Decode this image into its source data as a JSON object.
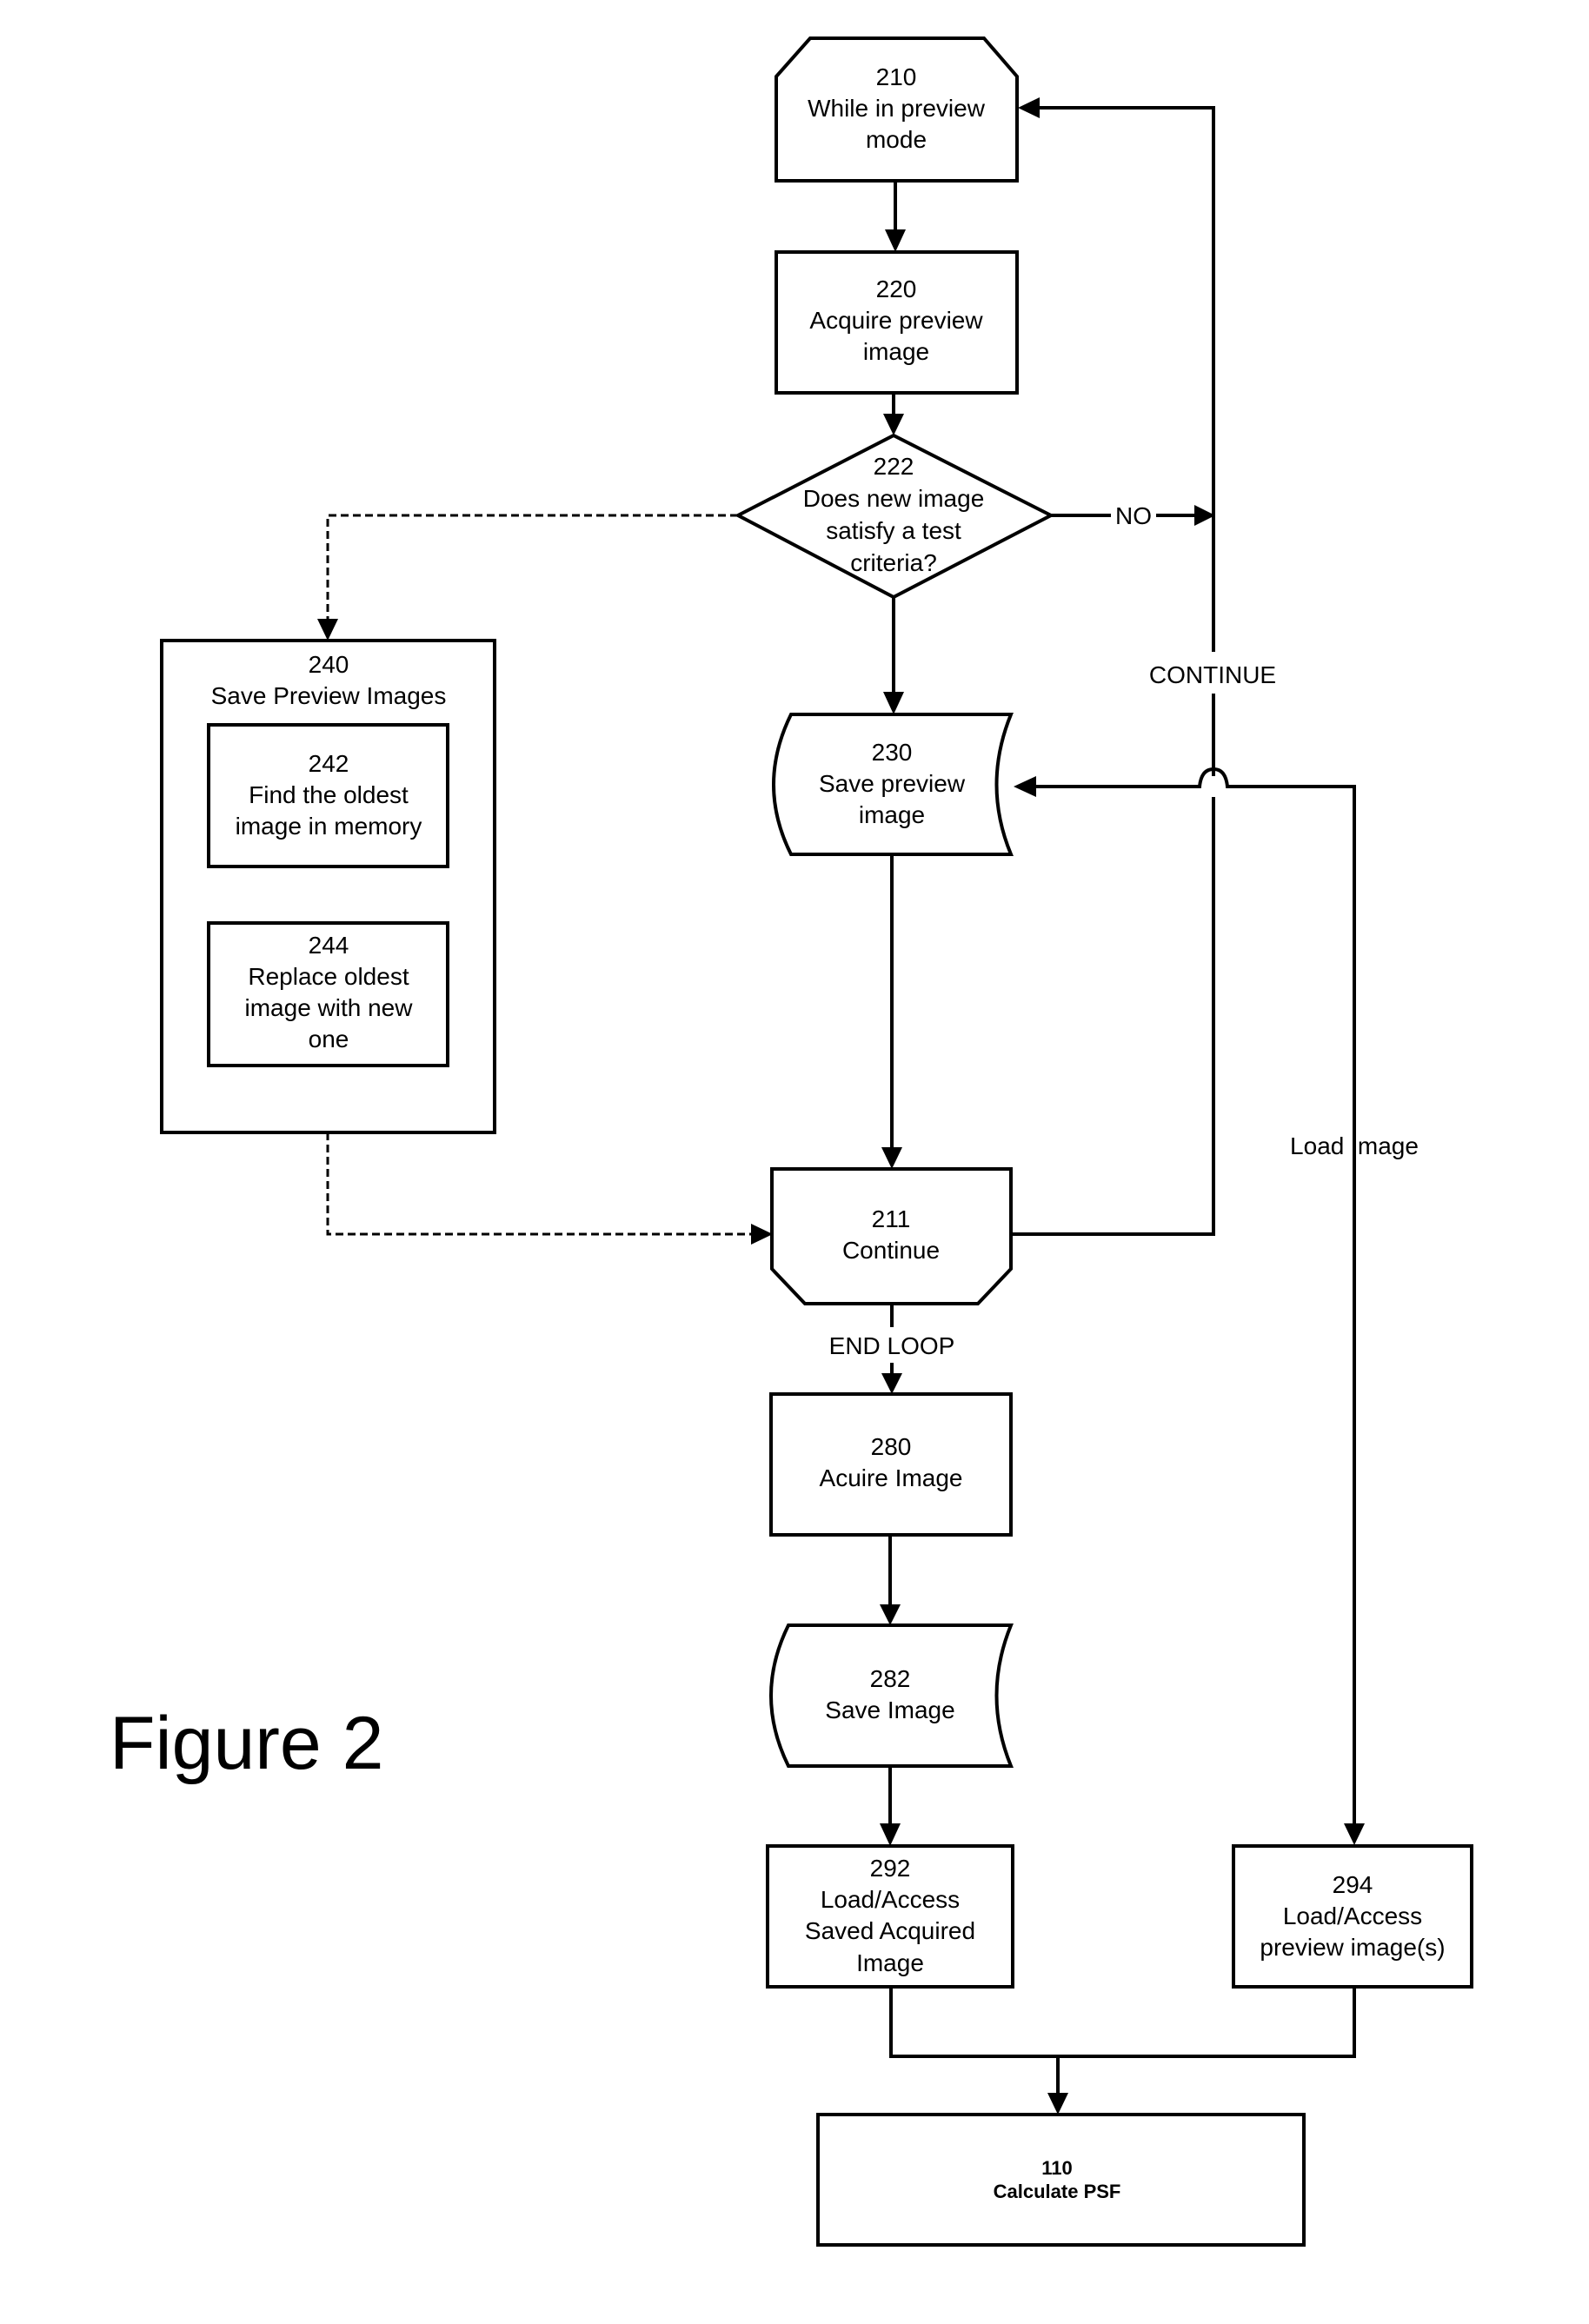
{
  "figure_label": "Figure 2",
  "nodes": {
    "n210": {
      "id": "210",
      "lines": [
        "While in preview",
        "mode"
      ]
    },
    "n220": {
      "id": "220",
      "lines": [
        "Acquire preview",
        "image"
      ]
    },
    "n222": {
      "id": "222",
      "lines": [
        "Does new image",
        "satisfy a test",
        "criteria?"
      ]
    },
    "n240": {
      "id": "240",
      "lines": [
        "Save Preview Images"
      ]
    },
    "n242": {
      "id": "242",
      "lines": [
        "Find the oldest",
        "image in memory"
      ]
    },
    "n244": {
      "id": "244",
      "lines": [
        "Replace oldest",
        "image with new",
        "one"
      ]
    },
    "n230": {
      "id": "230",
      "lines": [
        "Save preview",
        "image"
      ]
    },
    "n211": {
      "id": "211",
      "lines": [
        "Continue"
      ]
    },
    "n280": {
      "id": "280",
      "lines": [
        "Acuire Image"
      ]
    },
    "n282": {
      "id": "282",
      "lines": [
        "Save Image"
      ]
    },
    "n292": {
      "id": "292",
      "lines": [
        "Load/Access",
        "Saved Acquired",
        "Image"
      ]
    },
    "n294": {
      "id": "294",
      "lines": [
        "Load/Access",
        "preview image(s)"
      ]
    },
    "n110": {
      "id": "110",
      "lines": [
        "Calculate PSF"
      ]
    }
  },
  "edge_labels": {
    "no": "NO",
    "continue": "CONTINUE",
    "load_image": "Load Image",
    "end_loop": "END LOOP"
  }
}
